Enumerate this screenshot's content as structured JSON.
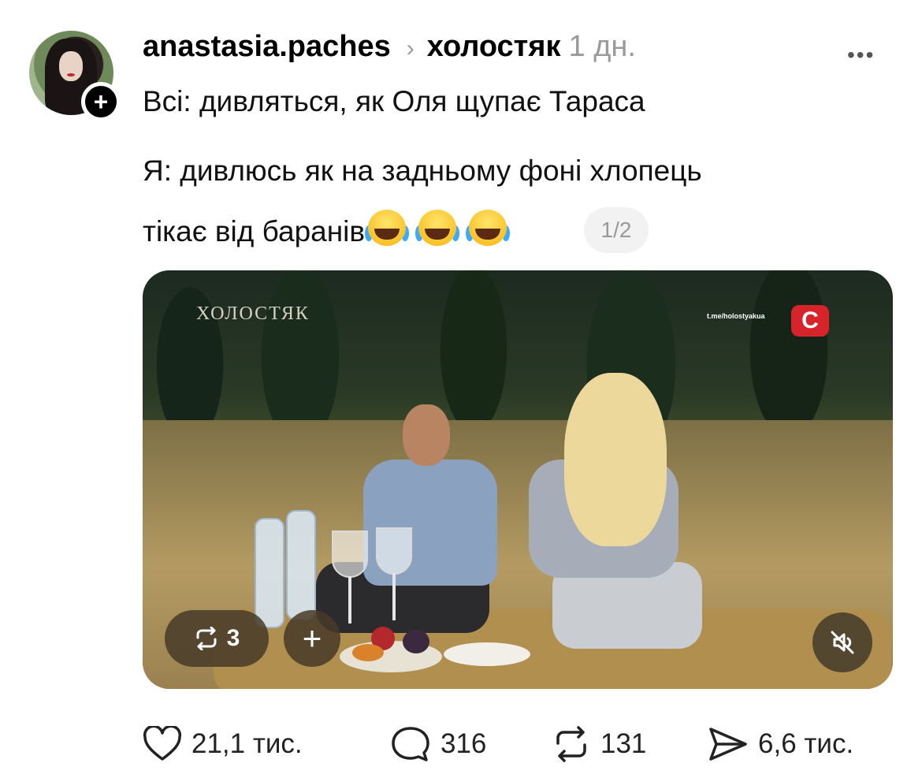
{
  "post": {
    "author": "anastasia.paches",
    "topic": "холостяк",
    "time": "1 дн.",
    "line1": "Всі: дивляться, як Оля щупає Тараса",
    "line2": "Я: дивлюсь як на задньому фоні хлопець",
    "line3": "тікає від баранів",
    "pager": "1/2"
  },
  "media": {
    "show_logo": "ХОЛОСТЯК",
    "telegram": "t.me/holostyakua",
    "channel_badge": "C",
    "repost_count": "3",
    "add_label": "+"
  },
  "actions": {
    "likes": "21,1 тис.",
    "replies": "316",
    "reposts": "131",
    "shares": "6,6 тис."
  },
  "icons": {
    "follow": "plus-icon",
    "more": "ellipsis-icon",
    "chevron": "chevron-right-icon",
    "repost": "repost-icon",
    "mute": "muted-speaker-icon",
    "like": "heart-icon",
    "reply": "comment-bubble-icon",
    "share": "send-icon"
  }
}
